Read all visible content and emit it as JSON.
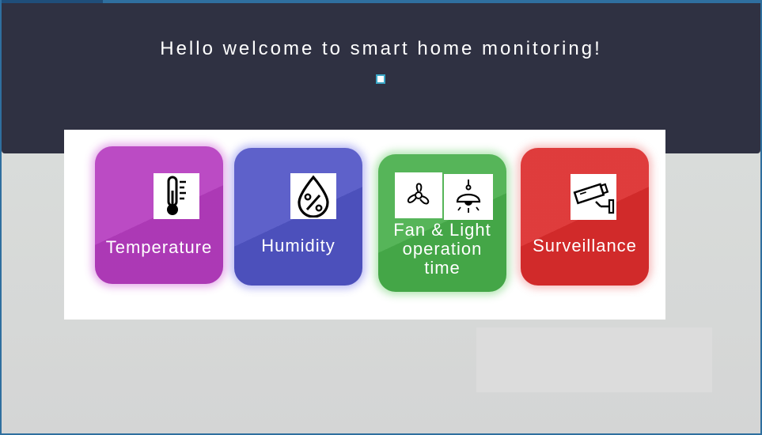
{
  "header": {
    "title": "Hello welcome to smart home monitoring!"
  },
  "tiles": [
    {
      "label": "Temperature",
      "icon": "thermometer-icon",
      "color": "#b53cbf"
    },
    {
      "label": "Humidity",
      "icon": "humidity-drop-icon",
      "color": "#5054c5"
    },
    {
      "label_lines": [
        "Fan & Light",
        "operation",
        "time"
      ],
      "icons": [
        "fan-icon",
        "ceiling-lamp-icon"
      ],
      "color": "#48af4b"
    },
    {
      "label": "Surveillance",
      "icon": "security-camera-icon",
      "color": "#dc2c2c"
    }
  ]
}
